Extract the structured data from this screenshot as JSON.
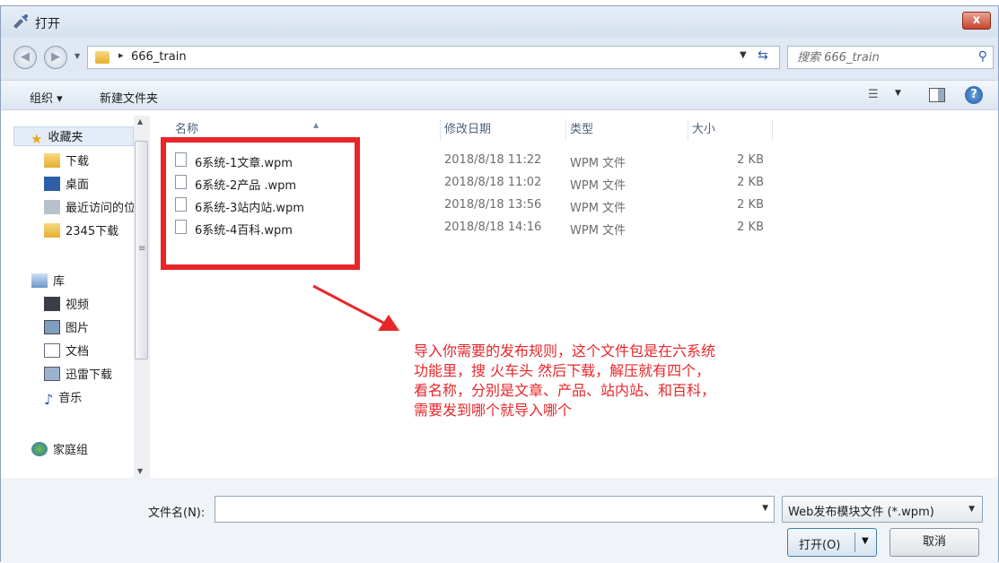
{
  "window": {
    "title": "打开",
    "close_label": "x"
  },
  "address": {
    "breadcrumb_arrow": "▸",
    "folder": "666_train",
    "search_placeholder": "搜索 666_train"
  },
  "toolbar": {
    "organize": "组织 ▾",
    "new_folder": "新建文件夹"
  },
  "sidebar": {
    "favorites": "收藏夹",
    "favorite_items": [
      "下载",
      "桌面",
      "最近访问的位",
      "2345下载"
    ],
    "libraries": "库",
    "library_items": [
      "视频",
      "图片",
      "文档",
      "迅雷下载",
      "音乐"
    ],
    "homegroup": "家庭组"
  },
  "columns": {
    "name": "名称",
    "modified": "修改日期",
    "type": "类型",
    "size": "大小"
  },
  "files": [
    {
      "name": "6系统-1文章.wpm",
      "modified": "2018/8/18 11:22",
      "type": "WPM 文件",
      "size": "2 KB"
    },
    {
      "name": "6系统-2产品 .wpm",
      "modified": "2018/8/18 11:02",
      "type": "WPM 文件",
      "size": "2 KB"
    },
    {
      "name": "6系统-3站内站.wpm",
      "modified": "2018/8/18 13:56",
      "type": "WPM 文件",
      "size": "2 KB"
    },
    {
      "name": "6系统-4百科.wpm",
      "modified": "2018/8/18 14:16",
      "type": "WPM 文件",
      "size": "2 KB"
    }
  ],
  "annotation": {
    "lines": [
      "导入你需要的发布规则，这个文件包是在六系统",
      "功能里，搜 火车头 然后下载，解压就有四个，",
      "看名称，分别是文章、产品、站内站、和百科，",
      "需要发到哪个就导入哪个"
    ],
    "color": "#e8262a"
  },
  "footer": {
    "filename_label": "文件名(N):",
    "filename_value": "",
    "filter": "Web发布模块文件 (*.wpm)",
    "open": "打开(O)",
    "cancel": "取消"
  }
}
